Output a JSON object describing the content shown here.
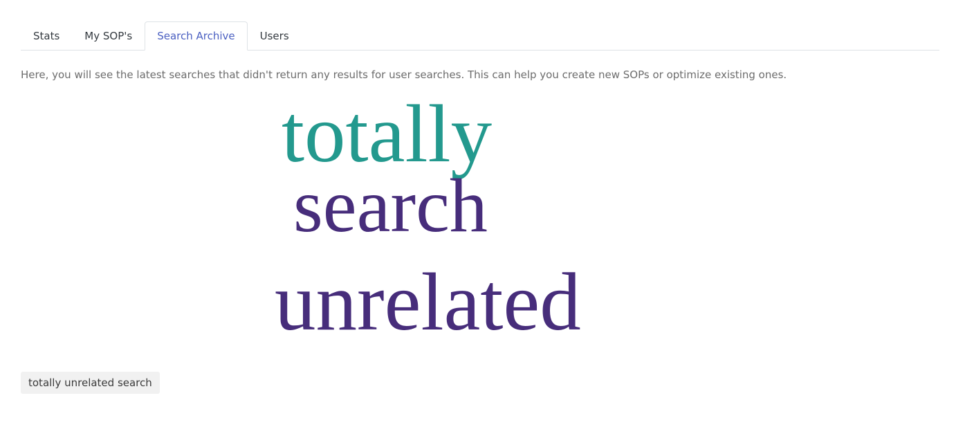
{
  "tabs": [
    {
      "label": "Stats",
      "active": false
    },
    {
      "label": "My SOP's",
      "active": false
    },
    {
      "label": "Search Archive",
      "active": true
    },
    {
      "label": "Users",
      "active": false
    }
  ],
  "intro_text": "Here, you will see the latest searches that didn't return any results for user searches. This can help you create new SOPs or optimize existing ones.",
  "word_cloud": {
    "words": [
      {
        "text": "totally",
        "color": "#23998e"
      },
      {
        "text": "search",
        "color": "#472d7b"
      },
      {
        "text": "unrelated",
        "color": "#472d7b"
      }
    ]
  },
  "searches": [
    {
      "label": "totally unrelated search"
    }
  ],
  "colors": {
    "active_tab": "#4a5fc1",
    "border": "#dee2e6",
    "chip_background": "#f1f1f1"
  }
}
